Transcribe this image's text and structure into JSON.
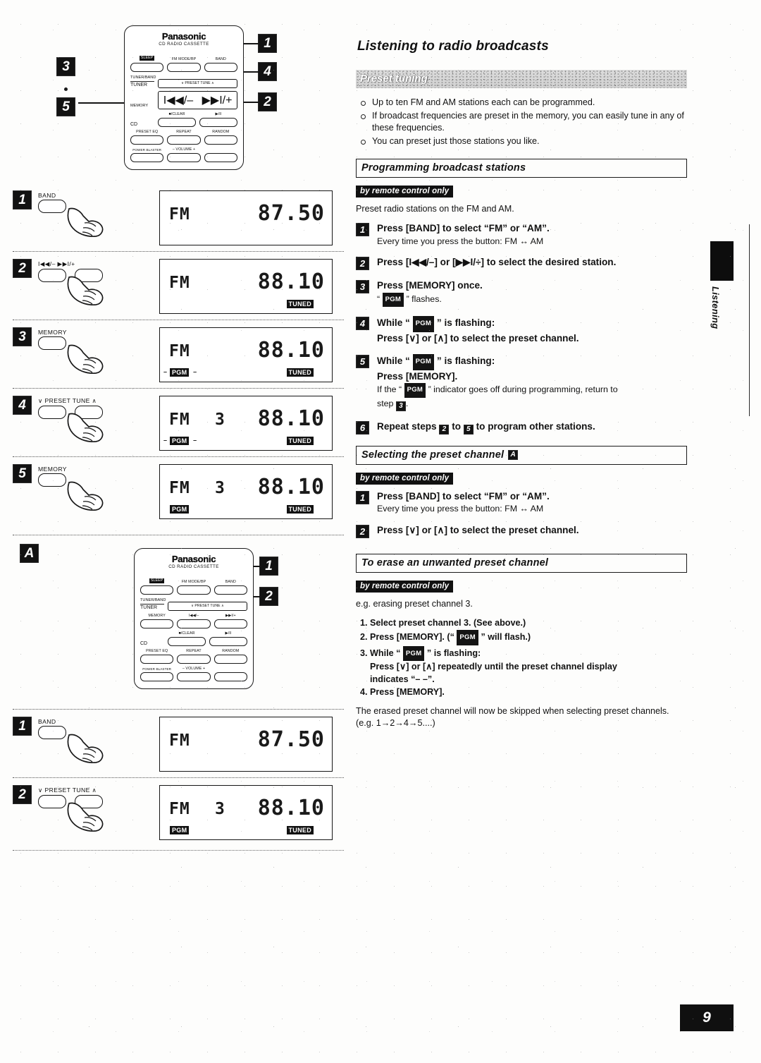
{
  "page": {
    "number": "9",
    "side_tab_label": "Listening",
    "title": "Listening to radio broadcasts"
  },
  "preset_tuning": {
    "banner": "Preset tuning",
    "bullets": [
      "Up to ten FM and AM stations each can be programmed.",
      "If broadcast frequencies are preset in the memory, you can easily tune in any of these frequencies.",
      "You can preset just those stations you like."
    ]
  },
  "programming": {
    "heading": "Programming broadcast stations",
    "remote_only": "by remote control only",
    "lead": "Preset radio stations on the FM and AM.",
    "steps": [
      {
        "num": "1",
        "main": "Press [BAND] to select “FM” or “AM”.",
        "sub": "Every time you press the button: FM ↔ AM"
      },
      {
        "num": "2",
        "main": "Press [I◀◀/–] or [▶▶I/÷] to select the desired station.",
        "sub": ""
      },
      {
        "num": "3",
        "main": "Press [MEMORY] once.",
        "sub": "“ PGM ” flashes."
      },
      {
        "num": "4",
        "main_a": "While “ PGM ” is flashing:",
        "main_b": "Press [∨] or [∧] to select the preset channel."
      },
      {
        "num": "5",
        "main_a": "While “ PGM ” is flashing:",
        "main_b": "Press [MEMORY].",
        "sub_a": "If the “ PGM ” indicator goes off during programming, return to",
        "sub_b": "step"
      },
      {
        "num": "6",
        "main_a": "Repeat steps",
        "main_b": "to",
        "main_c": "to program other stations.",
        "from": "2",
        "to": "5"
      }
    ],
    "step5_return_to": "3",
    "pgm_tag": "PGM"
  },
  "selecting": {
    "heading": "Selecting the preset channel",
    "heading_badge": "A",
    "remote_only": "by remote control only",
    "steps": [
      {
        "num": "1",
        "main": "Press [BAND] to select “FM” or “AM”.",
        "sub": "Every time you press the button: FM ↔ AM"
      },
      {
        "num": "2",
        "main": "Press [∨] or [∧] to select the preset channel.",
        "sub": ""
      }
    ]
  },
  "erase": {
    "heading": "To erase an unwanted preset channel",
    "remote_only": "by remote control only",
    "lead": "e.g. erasing preset channel 3.",
    "items": [
      "Select preset channel 3. (See above.)",
      "Press [MEMORY]. (“ PGM ” will flash.)",
      "While “ PGM ” is flashing:",
      "Press [MEMORY]."
    ],
    "item3_cont_a": "Press [∨] or [∧] repeatedly until the preset channel display",
    "item3_cont_b": "indicates “– –”.",
    "tail_a": "The erased preset channel will now be skipped when selecting preset",
    "tail_b": "channels. (e.g. 1→2→4→5....)"
  },
  "remote": {
    "brand": "Panasonic",
    "subtitle": "CD RADIO CASSETTE",
    "rows": [
      {
        "keys": [
          "SLEEP",
          "FM MODE/BP",
          "BAND"
        ]
      },
      {
        "side": "TUNER/BAND",
        "side2": "TUNER",
        "group": "∨ PRESET TUNE ∧"
      },
      {
        "side": "MEMORY",
        "keys": [
          "I◀◀/–",
          "▶▶I/+"
        ]
      },
      {
        "side": "CD",
        "keys": [
          "■/CLEAR",
          "▶/II"
        ]
      },
      {
        "keys": [
          "PRESET EQ",
          "REPEAT",
          "RANDOM"
        ]
      },
      {
        "keys": [
          "POWER BLASTER",
          "– VOLUME +"
        ]
      }
    ],
    "callouts_top": [
      "1",
      "4",
      "2"
    ],
    "callouts_left": [
      "3",
      "5"
    ],
    "callouts_a": [
      "1",
      "2"
    ]
  },
  "illustrations": {
    "programming_panels": [
      {
        "num": "1",
        "button_label": "BAND",
        "buttons": 1,
        "lcd": {
          "band": "FM",
          "channel": "",
          "freq": "87.50",
          "pgm": "off",
          "tuned": false
        }
      },
      {
        "num": "2",
        "button_label": "I◀◀/–   ▶▶I/+",
        "buttons": 2,
        "lcd": {
          "band": "FM",
          "channel": "",
          "freq": "88.10",
          "pgm": "off",
          "tuned": true
        }
      },
      {
        "num": "3",
        "button_label": "MEMORY",
        "buttons": 1,
        "lcd": {
          "band": "FM",
          "channel": "",
          "freq": "88.10",
          "pgm": "flash",
          "tuned": true
        }
      },
      {
        "num": "4",
        "button_label": "∨ PRESET TUNE ∧",
        "buttons": 2,
        "lcd": {
          "band": "FM",
          "channel": "3",
          "freq": "88.10",
          "pgm": "flash",
          "tuned": true
        }
      },
      {
        "num": "5",
        "button_label": "MEMORY",
        "buttons": 1,
        "lcd": {
          "band": "FM",
          "channel": "3",
          "freq": "88.10",
          "pgm": "on",
          "tuned": true
        }
      }
    ],
    "selecting_panels": [
      {
        "num": "1",
        "button_label": "BAND",
        "buttons": 1,
        "lcd": {
          "band": "FM",
          "channel": "",
          "freq": "87.50",
          "pgm": "off",
          "tuned": false
        }
      },
      {
        "num": "2",
        "button_label": "∨ PRESET TUNE ∧",
        "buttons": 2,
        "lcd": {
          "band": "FM",
          "channel": "3",
          "freq": "88.10",
          "pgm": "on",
          "tuned": true
        }
      }
    ],
    "section_a_badge": "A"
  }
}
